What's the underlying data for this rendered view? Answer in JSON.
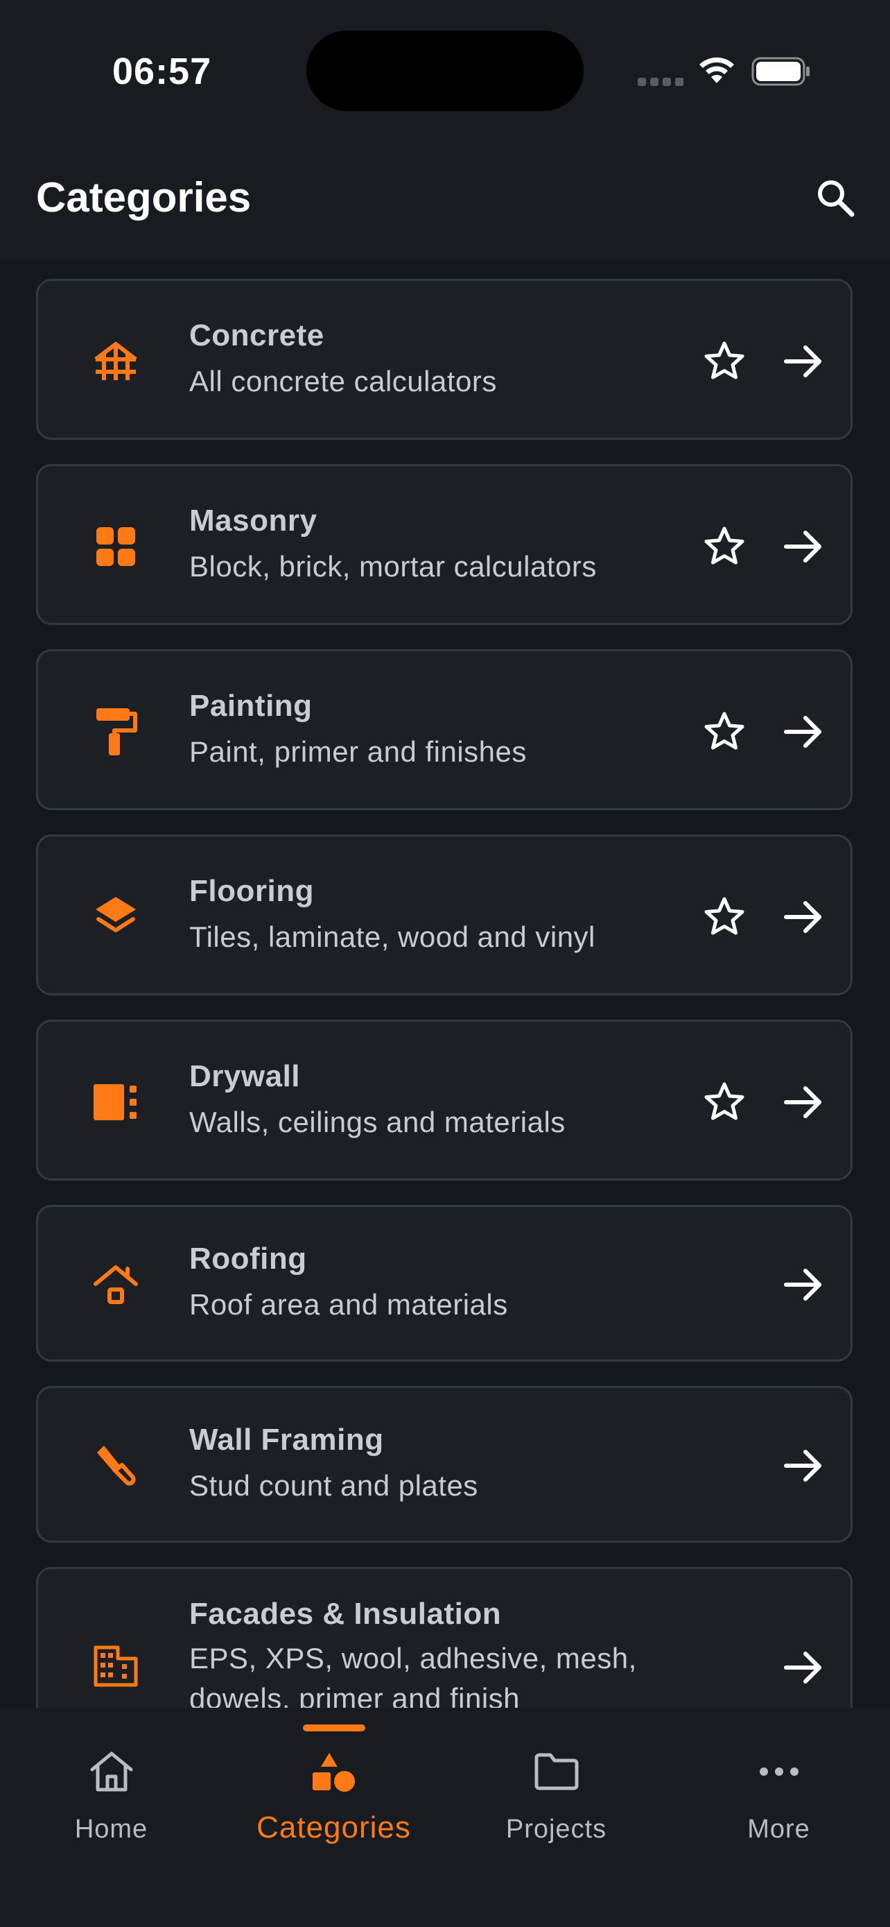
{
  "status_bar": {
    "time": "06:57"
  },
  "header": {
    "title": "Categories"
  },
  "categories": [
    {
      "title": "Concrete",
      "subtitle": "All concrete calculators",
      "icon": "concrete-icon"
    },
    {
      "title": "Masonry",
      "subtitle": "Block, brick, mortar calculators",
      "icon": "masonry-grid-icon"
    },
    {
      "title": "Painting",
      "subtitle": "Paint, primer and finishes",
      "icon": "paint-roller-icon"
    },
    {
      "title": "Flooring",
      "subtitle": "Tiles, laminate, wood and vinyl",
      "icon": "layers-icon"
    },
    {
      "title": "Drywall",
      "subtitle": "Walls, ceilings and materials",
      "icon": "drywall-panel-icon"
    },
    {
      "title": "Roofing",
      "subtitle": "Roof area and materials",
      "icon": "roof-house-icon"
    },
    {
      "title": "Wall Framing",
      "subtitle": "Stud count and plates",
      "icon": "hammer-icon"
    },
    {
      "title": "Facades & Insulation",
      "subtitle": "EPS, XPS, wool, adhesive, mesh, dowels, primer and finish",
      "icon": "building-icon"
    }
  ],
  "tabs": [
    {
      "label": "Home",
      "icon": "home-icon"
    },
    {
      "label": "Categories",
      "icon": "shapes-icon"
    },
    {
      "label": "Projects",
      "icon": "folder-icon"
    },
    {
      "label": "More",
      "icon": "more-dots-icon"
    }
  ],
  "colors": {
    "accent": "#ff7a14",
    "background": "#14181c",
    "card": "#1c2025",
    "card_border": "#34393f",
    "text": "#c9ccd1"
  }
}
